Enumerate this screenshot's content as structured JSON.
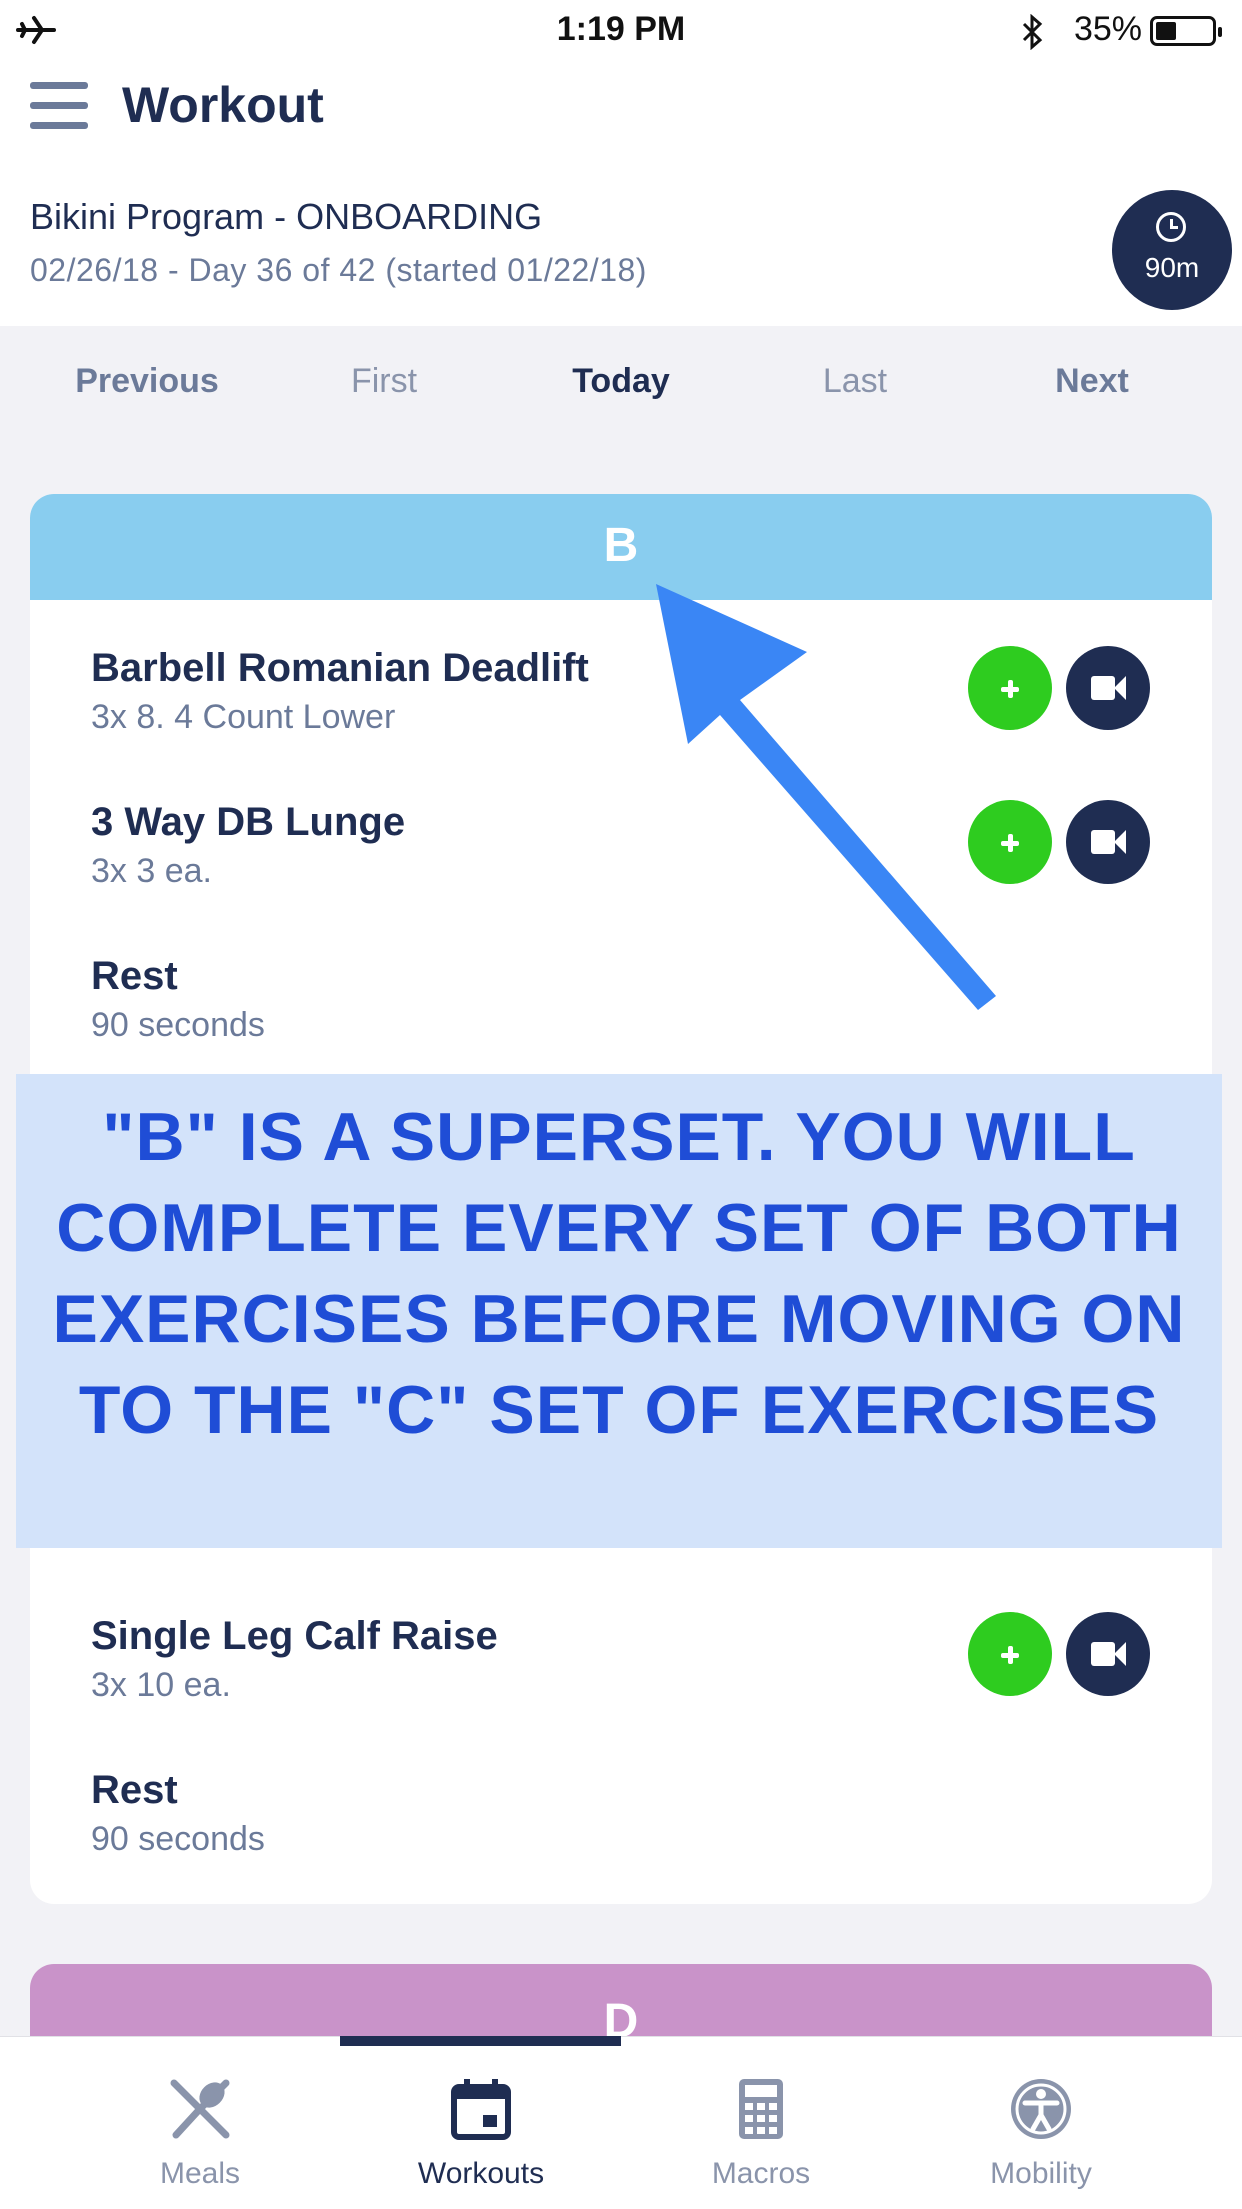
{
  "status_bar": {
    "time": "1:19 PM",
    "battery": "35%"
  },
  "header": {
    "title": "Workout",
    "program_name": "Bikini Program - ONBOARDING",
    "program_date": "02/26/18 - Day 36 of 42 (started 01/22/18)",
    "timer_label": "90m"
  },
  "day_nav": {
    "previous": "Previous",
    "first": "First",
    "today": "Today",
    "last": "Last",
    "next": "Next"
  },
  "card_b": {
    "label": "B",
    "exercises": [
      {
        "name": "Barbell Romanian Deadlift",
        "detail": "3x 8. 4 Count Lower"
      },
      {
        "name": "3 Way DB Lunge",
        "detail": "3x 3 ea."
      },
      {
        "name": "Rest",
        "detail": "90 seconds"
      },
      {
        "name": "Single Leg Calf Raise",
        "detail": "3x 10 ea."
      },
      {
        "name": "Rest",
        "detail": "90 seconds"
      }
    ]
  },
  "overlay": {
    "text": "\"B\" IS A SUPERSET. YOU WILL COMPLETE EVERY SET OF BOTH EXERCISES BEFORE MOVING ON TO THE \"C\" SET OF EXERCISES"
  },
  "card_d": {
    "label": "D"
  },
  "tabs": [
    {
      "label": "Meals",
      "icon": "utensils-icon"
    },
    {
      "label": "Workouts",
      "icon": "calendar-icon",
      "active": true
    },
    {
      "label": "Macros",
      "icon": "calculator-icon"
    },
    {
      "label": "Mobility",
      "icon": "accessibility-icon"
    }
  ],
  "colors": {
    "navy": "#1f2d52",
    "card_b_header": "#89cdef",
    "card_d_header": "#c993c9",
    "add_green": "#2ecc1f",
    "overlay_bg": "#d3e3fa",
    "overlay_text": "#1f4dd6",
    "arrow": "#3a86f5"
  }
}
